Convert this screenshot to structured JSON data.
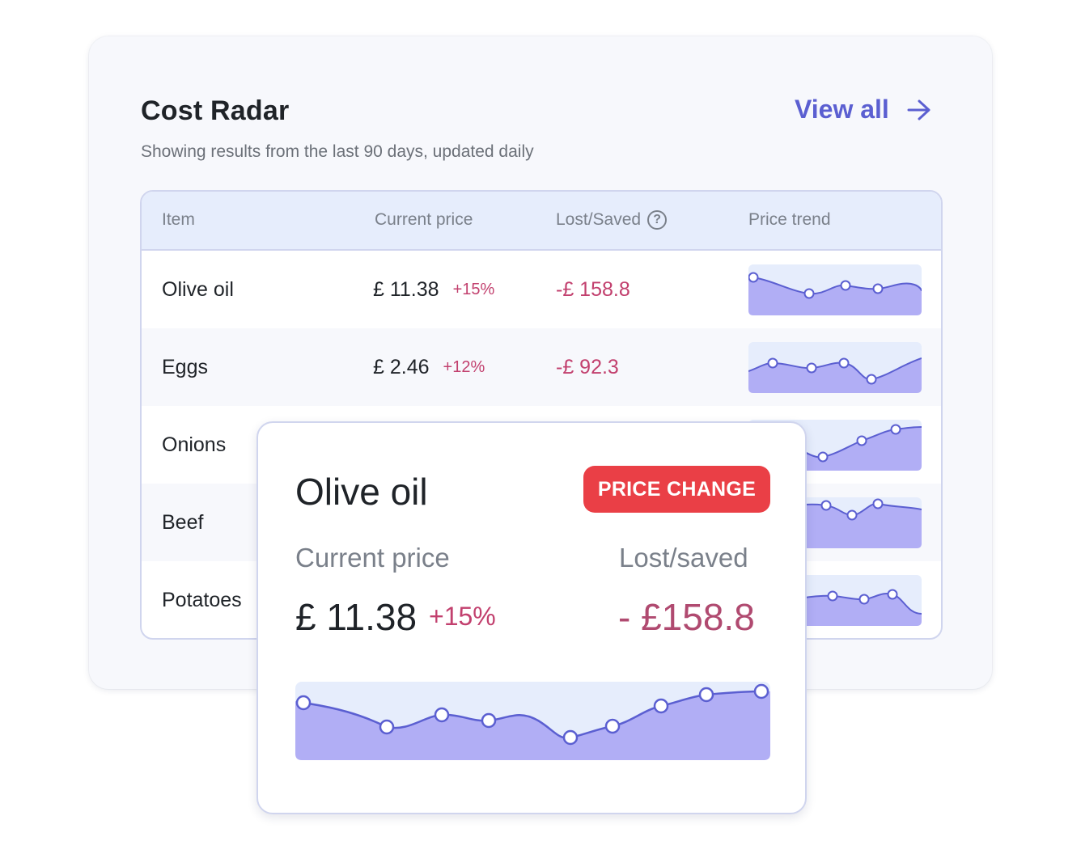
{
  "card": {
    "title": "Cost Radar",
    "subtitle": "Showing results from the last 90 days, updated daily",
    "view_all_label": "View all"
  },
  "table": {
    "headers": {
      "item": "Item",
      "current_price": "Current price",
      "lost_saved": "Lost/Saved",
      "price_trend": "Price trend"
    },
    "rows": [
      {
        "item": "Olive oil",
        "price": "£ 11.38",
        "change": "+15%",
        "lost_saved": "-£ 158.8"
      },
      {
        "item": "Eggs",
        "price": "£ 2.46",
        "change": "+12%",
        "lost_saved": "-£ 92.3"
      },
      {
        "item": "Onions",
        "price": "",
        "change": "",
        "lost_saved": ""
      },
      {
        "item": "Beef",
        "price": "",
        "change": "",
        "lost_saved": ""
      },
      {
        "item": "Potatoes",
        "price": "",
        "change": "",
        "lost_saved": ""
      }
    ]
  },
  "popup": {
    "title": "Olive oil",
    "badge": "PRICE CHANGE",
    "current_price_label": "Current price",
    "lost_saved_label": "Lost/saved",
    "current_price": "£ 11.38",
    "change": "+15%",
    "lost_saved": "- £158.8"
  },
  "colors": {
    "accent": "#5b5fd1",
    "spark_fill": "#b1aef5",
    "spark_bg": "#e6edfc",
    "spark_line": "#5b5fd1",
    "negative": "#c2406e",
    "badge": "#ea3f46"
  },
  "icons": {
    "view_all": "arrow-right-icon",
    "help": "question-circle-icon"
  }
}
